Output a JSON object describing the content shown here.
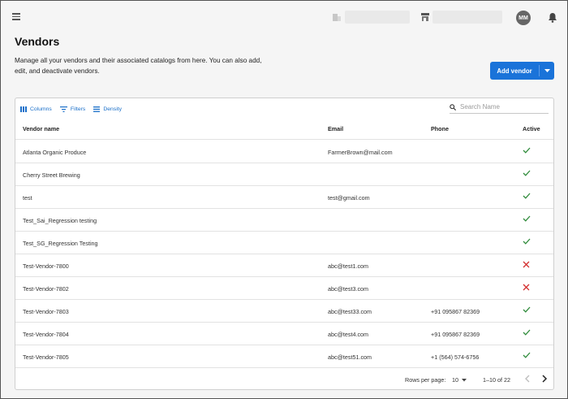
{
  "header": {
    "avatar_initials": "MM"
  },
  "page": {
    "title": "Vendors",
    "description": "Manage all your vendors and their associated catalogs from here. You can also add, edit, and deactivate vendors.",
    "add_button_label": "Add vendor"
  },
  "toolbar": {
    "columns_label": "Columns",
    "filters_label": "Filters",
    "density_label": "Density",
    "search_placeholder": "Search Name"
  },
  "table": {
    "headers": {
      "name": "Vendor name",
      "email": "Email",
      "phone": "Phone",
      "active": "Active"
    },
    "rows": [
      {
        "name": "Atlanta Organic Produce",
        "email": "FarmerBrown@mail.com",
        "phone": "",
        "active": true
      },
      {
        "name": "Cherry Street Brewing",
        "email": "",
        "phone": "",
        "active": true
      },
      {
        "name": "test",
        "email": "test@gmail.com",
        "phone": "",
        "active": true
      },
      {
        "name": "Test_Sai_Regression testing",
        "email": "",
        "phone": "",
        "active": true
      },
      {
        "name": "Test_SG_Regression Testing",
        "email": "",
        "phone": "",
        "active": true
      },
      {
        "name": "Test-Vendor-7800",
        "email": "abc@test1.com",
        "phone": "",
        "active": false
      },
      {
        "name": "Test-Vendor-7802",
        "email": "abc@test3.com",
        "phone": "",
        "active": false
      },
      {
        "name": "Test-Vendor-7803",
        "email": "abc@test33.com",
        "phone": "+91 095867 82369",
        "active": true
      },
      {
        "name": "Test-Vendor-7804",
        "email": "abc@test4.com",
        "phone": "+91 095867 82369",
        "active": true
      },
      {
        "name": "Test-Vendor-7805",
        "email": "abc@test51.com",
        "phone": "+1 (564) 574-6756",
        "active": true
      }
    ]
  },
  "pagination": {
    "rows_per_page_label": "Rows per page:",
    "rows_per_page_value": "10",
    "range_text": "1–10 of 22"
  },
  "colors": {
    "primary": "#1a73d9",
    "active_check": "#2e8b3a",
    "inactive_x": "#d32f2f"
  }
}
